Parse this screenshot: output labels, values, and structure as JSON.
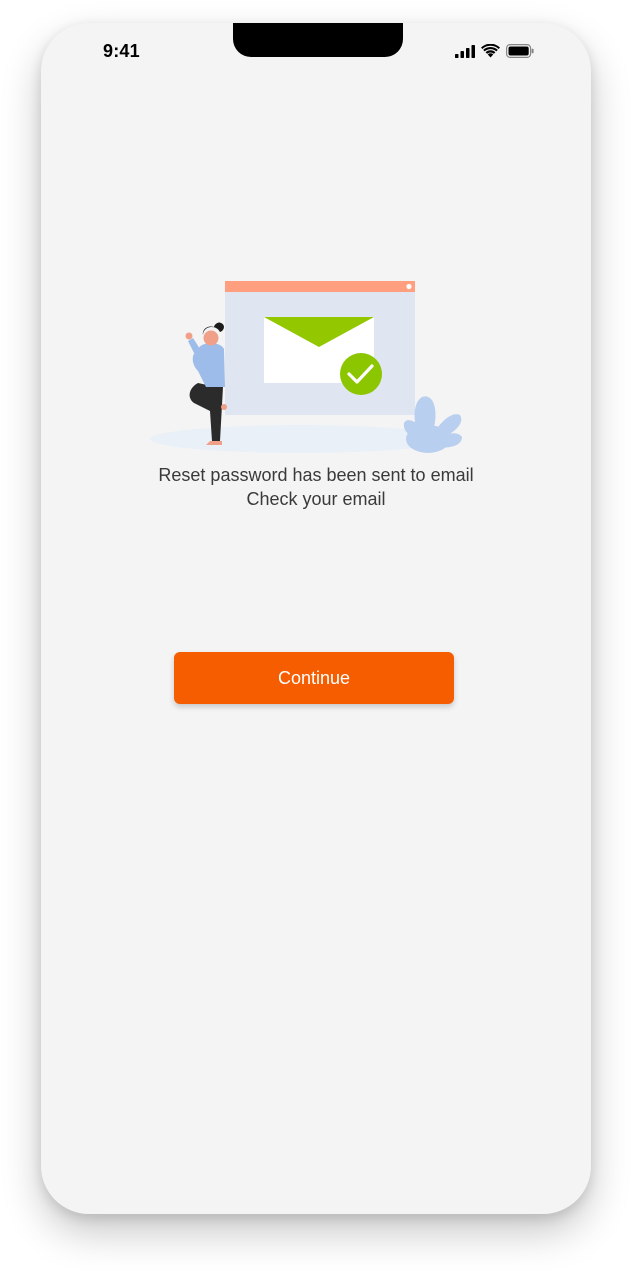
{
  "status_bar": {
    "time": "9:41",
    "icons": [
      "cellular-signal-icon",
      "wifi-icon",
      "battery-icon"
    ]
  },
  "illustration": {
    "name": "email-sent-illustration",
    "colors": {
      "window_bar": "#ff9f80",
      "window_body": "#dfe6f2",
      "envelope_flap": "#93c700",
      "check_badge": "#8cc600",
      "plant": "#b9cff0",
      "person_top": "#9ebcea",
      "person_pants": "#2b2b2b"
    }
  },
  "message": {
    "line1": "Reset password has been sent to email",
    "line2": "Check your email"
  },
  "actions": {
    "continue_label": "Continue"
  },
  "colors": {
    "accent": "#f55d00",
    "background": "#f4f4f4",
    "text": "#3a3a3a"
  }
}
